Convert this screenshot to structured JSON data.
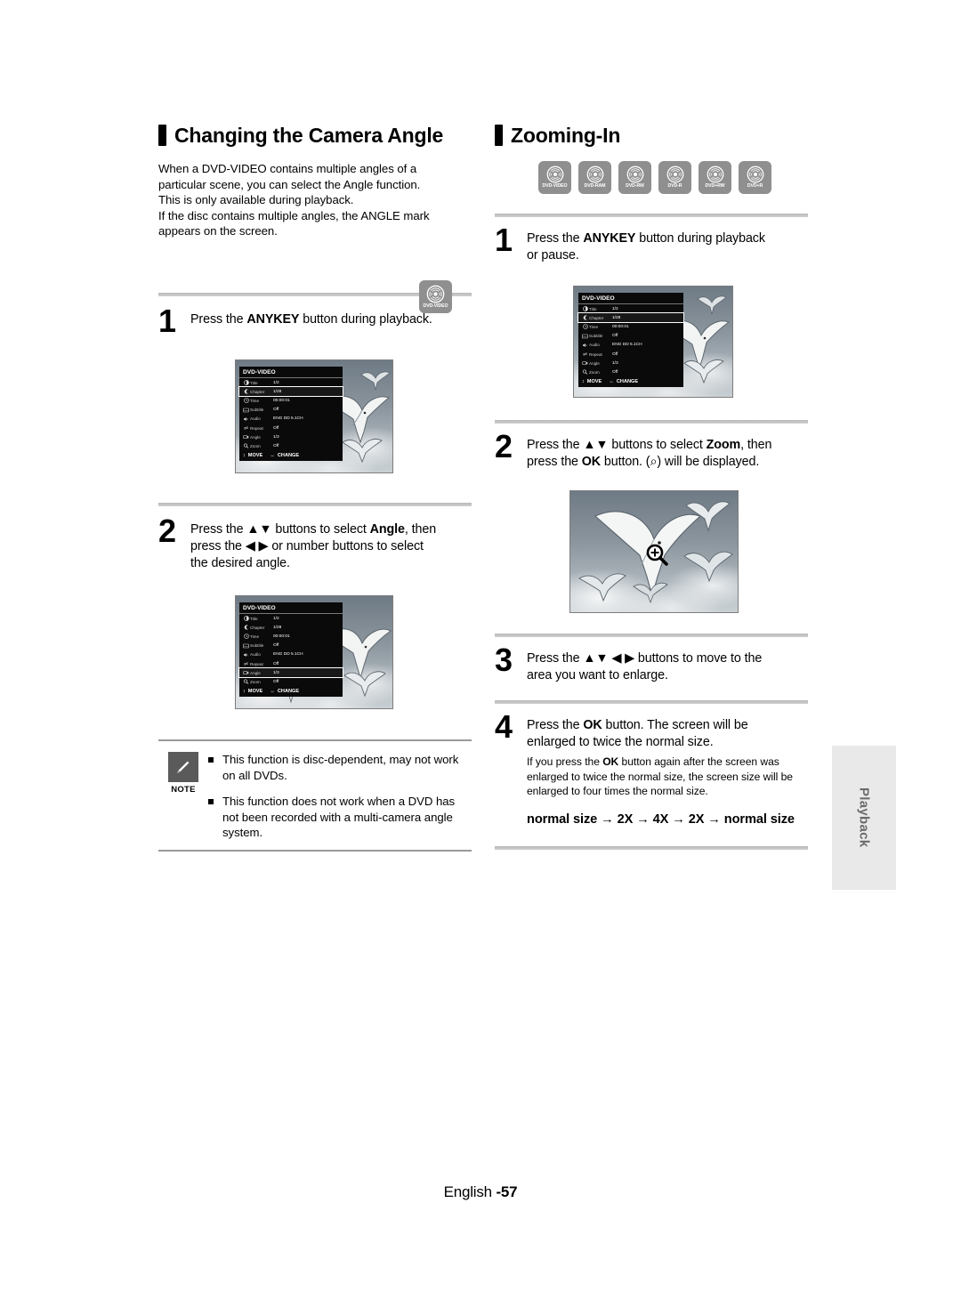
{
  "page": {
    "footer_language": "English ",
    "footer_number": "-57",
    "side_tab": "Playback"
  },
  "left": {
    "heading": "Changing the Camera Angle",
    "intro": "When a DVD-VIDEO contains multiple angles of a particular scene, you can select the Angle function. This is only available during playback.\nIf the disc contains multiple angles, the ANGLE mark appears on the screen.",
    "intro_line1": "When a DVD-VIDEO contains multiple angles of a",
    "intro_line2": "particular scene, you can select the Angle function.",
    "intro_line3": "This is only available during playback.",
    "intro_line4": "If the disc contains multiple angles, the ANGLE mark",
    "intro_line5": "appears on the screen.",
    "disc_badge": "DVD-VIDEO",
    "step1_num": "1",
    "step1_line1_a": "Press the ",
    "step1_line1_b": "ANYKEY",
    "step1_line1_c": " button during playback.",
    "step2_num": "2",
    "step2_a": "Press the ",
    "step2_updown": "▲▼",
    "step2_b": " buttons to select ",
    "step2_bold": "Angle",
    "step2_c": ", then",
    "step2_d": "press the ",
    "step2_leftright": "◀ ▶",
    "step2_e": " or number buttons to select",
    "step2_f": "the desired angle.",
    "note_label": "NOTE",
    "notes": [
      "This function is disc-dependent, may not work on all DVDs.",
      "This function does not work when a DVD has not been recorded with a multi-camera angle system."
    ]
  },
  "right": {
    "heading": "Zooming-In",
    "disc_badges": [
      "DVD-VIDEO",
      "DVD-RAM",
      "DVD-RW",
      "DVD-R",
      "DVD+RW",
      "DVD+R"
    ],
    "step1_num": "1",
    "step1_a": "Press the ",
    "step1_bold": "ANYKEY",
    "step1_b": " button during playback",
    "step1_c": "or pause.",
    "step2_num": "2",
    "step2_a": "Press the ",
    "step2_updown": "▲▼",
    "step2_b": " buttons to select ",
    "step2_bold": "Zoom",
    "step2_c": ", then",
    "step2_d": "press the ",
    "step2_bold2": "OK",
    "step2_e": " button. (",
    "step2_glyph": "⌕",
    "step2_f": ") will be displayed.",
    "step3_num": "3",
    "step3_a": "Press the ",
    "step3_updown": "▲▼",
    "step3_leftright": "◀ ▶",
    "step3_b": " buttons to move to the",
    "step3_c": "area you want to enlarge.",
    "step4_num": "4",
    "step4_a": "Press the ",
    "step4_bold": "OK",
    "step4_b": " button. The screen will be",
    "step4_c": "enlarged to twice the normal size.",
    "step4_sub_a": "If you press the ",
    "step4_sub_bold": "OK",
    "step4_sub_b": " button again after the screen was enlarged to twice the normal size, the screen size will be enlarged to four times the normal size.",
    "step4_emph": "normal size → 2X → 4X → 2X → normal size",
    "zoom_cursor_icon": "magnifier-plus-icon"
  },
  "osd": {
    "title": "DVD-VIDEO",
    "rows": [
      {
        "icon": "title-icon",
        "label": "Title",
        "value": "1/2"
      },
      {
        "icon": "chapter-icon",
        "label": "Chapter",
        "value": "1/28"
      },
      {
        "icon": "time-icon",
        "label": "Time",
        "value": "00:00:01"
      },
      {
        "icon": "subtitle-icon",
        "label": "Subtitle",
        "value": "Off"
      },
      {
        "icon": "audio-icon",
        "label": "Audio",
        "value": "ENG DD 5.1CH"
      },
      {
        "icon": "repeat-icon",
        "label": "Repeat",
        "value": "Off"
      },
      {
        "icon": "angle-icon",
        "label": "Angle",
        "value": "1/3"
      },
      {
        "icon": "zoom-icon",
        "label": "Zoom",
        "value": "Off"
      }
    ],
    "footer_move": "MOVE",
    "footer_change": "CHANGE",
    "footer_move_glyph": "↕",
    "footer_change_glyph": "↔",
    "selected_chapter_index": 1,
    "selected_angle_index": 6
  },
  "colors": {
    "ink": "#000000",
    "rule": "#b9b9b9",
    "osd_bg": "#0a0a0a",
    "disc_badge_bg": "#8f8f8f",
    "note_badge_bg": "#5a5a5a",
    "sidetab_bg": "#e9e9e9",
    "sidetab_text": "#6b6b6b"
  }
}
